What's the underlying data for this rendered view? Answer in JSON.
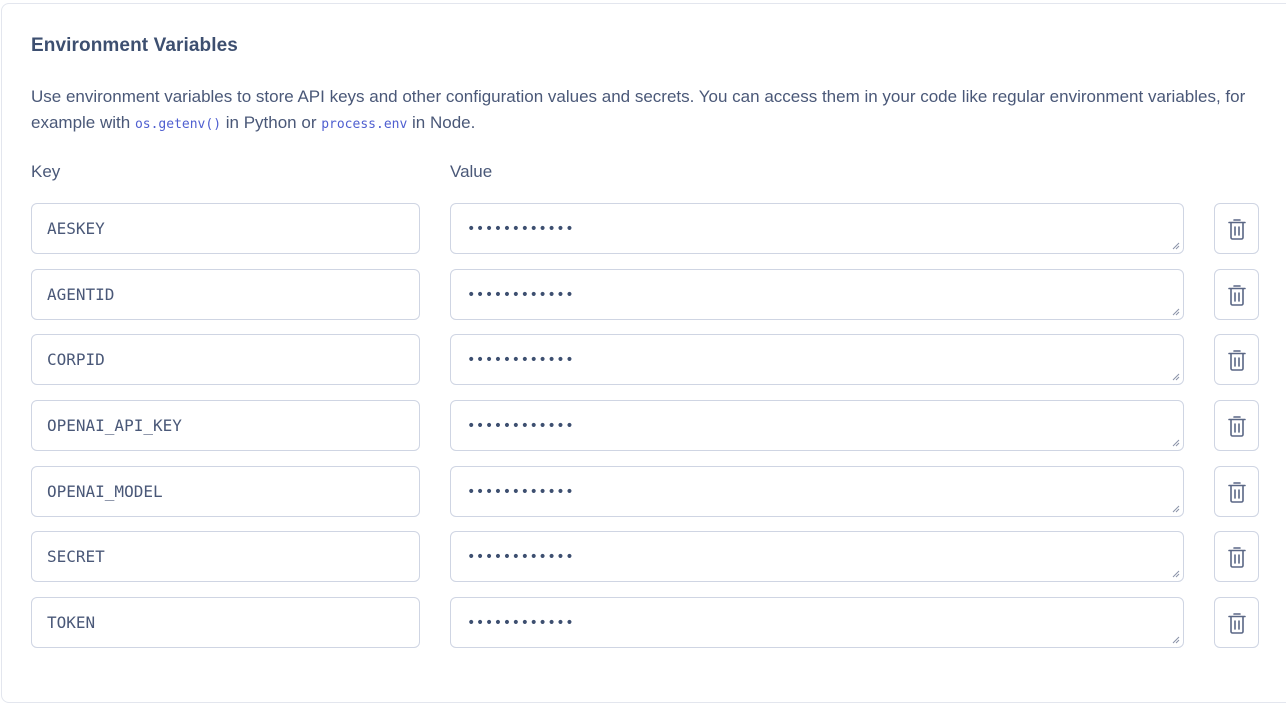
{
  "section": {
    "title": "Environment Variables",
    "description": {
      "part1": "Use environment variables to store API keys and other configuration values and secrets. You can access them in your code like regular environment variables, for example with ",
      "code1": "os.getenv()",
      "part2": " in Python or ",
      "code2": "process.env",
      "part3": " in Node."
    }
  },
  "columns": {
    "key_label": "Key",
    "value_label": "Value"
  },
  "variables": [
    {
      "key": "AESKEY",
      "value": "••••••••••••"
    },
    {
      "key": "AGENTID",
      "value": "••••••••••••"
    },
    {
      "key": "CORPID",
      "value": "••••••••••••"
    },
    {
      "key": "OPENAI_API_KEY",
      "value": "••••••••••••"
    },
    {
      "key": "OPENAI_MODEL",
      "value": "••••••••••••"
    },
    {
      "key": "SECRET",
      "value": "••••••••••••"
    },
    {
      "key": "TOKEN",
      "value": "••••••••••••"
    }
  ],
  "icons": {
    "delete": "trash-icon",
    "resize": "resize-handle-icon"
  },
  "colors": {
    "heading": "#3d4f70",
    "text": "#4a5878",
    "code": "#4f5fd0",
    "border": "#cfd5e3"
  }
}
